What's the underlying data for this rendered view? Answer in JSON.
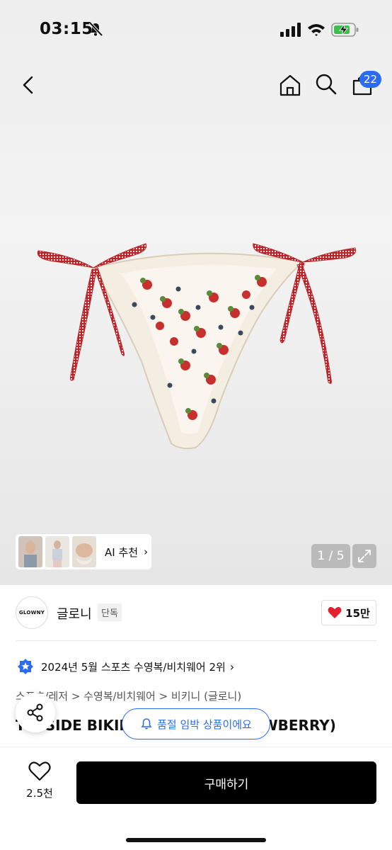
{
  "status_bar": {
    "time": "03:15"
  },
  "header": {
    "cart_badge": "22"
  },
  "gallery": {
    "counter": "1 / 5",
    "ai_label": "AI 추천",
    "ai_chevron": "›"
  },
  "brand": {
    "logo_text": "GLOWNY",
    "name": "글로니",
    "exclusive": "단독",
    "likes": "15만"
  },
  "ranking": {
    "text": "2024년 5월 스포츠 수영복/비치웨어 2위",
    "chevron": "›"
  },
  "breadcrumb": "스포츠/레저  >  수영복/비치웨어  >  비키니 (글로니)",
  "product_name": "TIE SIDE BIKINI BOTTOM (STRAWBERRY)",
  "toast": "품절 임박 상품이에요",
  "bottom": {
    "fav_count": "2.5천",
    "buy_label": "구매하기"
  },
  "colors": {
    "accent": "#2b6cf0",
    "heart": "#e5202e",
    "tie": "#b8262b"
  },
  "icons": [
    "silent-bell-icon",
    "signal-icon",
    "wifi-icon",
    "battery-charging-icon",
    "back-arrow-icon",
    "home-icon",
    "search-icon",
    "cart-icon",
    "expand-icon",
    "heart-icon",
    "ranking-star-icon",
    "share-icon",
    "bell-icon"
  ]
}
